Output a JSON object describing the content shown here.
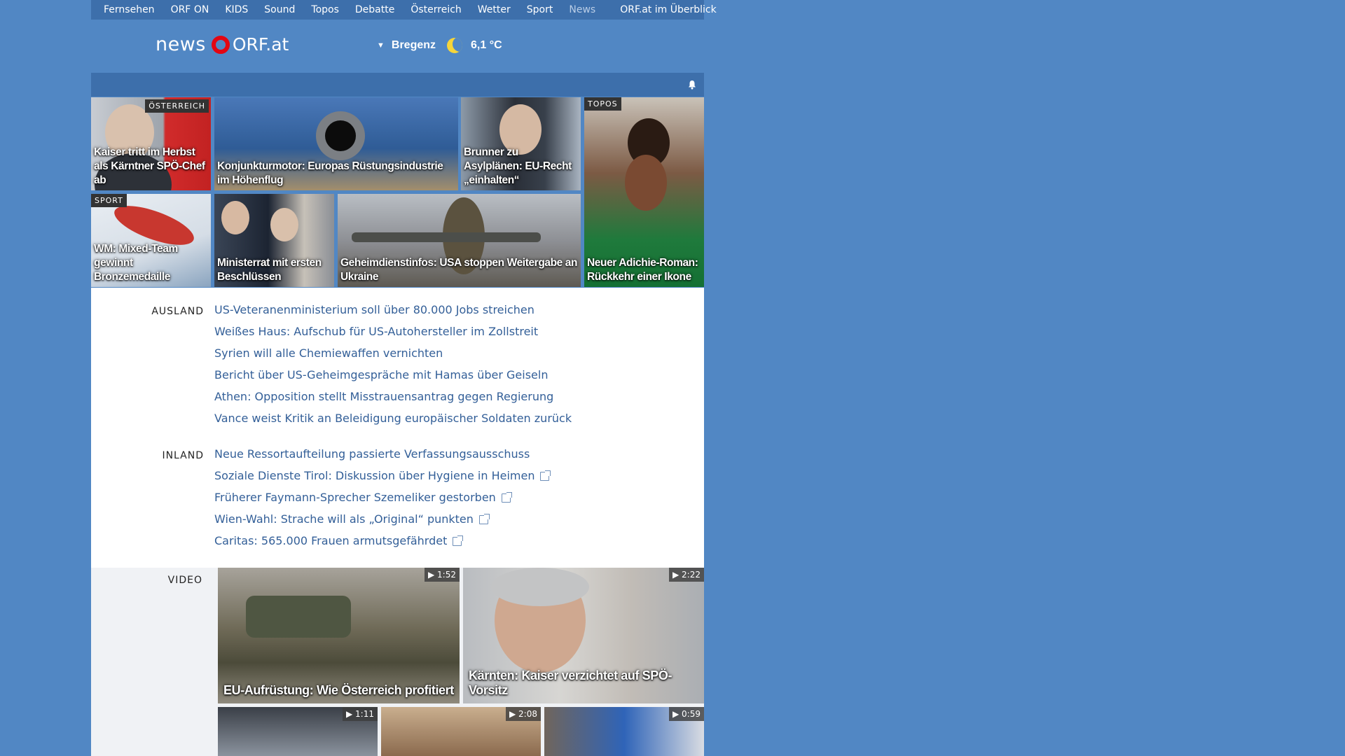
{
  "nav": {
    "items": [
      "Fernsehen",
      "ORF ON",
      "KIDS",
      "Sound",
      "Topos",
      "Debatte",
      "Österreich",
      "Wetter",
      "Sport"
    ],
    "current": "News",
    "overview": "ORF.at im Überblick"
  },
  "logo": {
    "news": "news",
    "orf": "ORF.at"
  },
  "weather": {
    "arrow": "▼",
    "city": "Bregenz",
    "temp": "6,1 °C",
    "icon": "moon-icon"
  },
  "teasers": {
    "t1": {
      "tag": "ÖSTERREICH",
      "caption": "Kaiser tritt im Herbst als Kärntner SPÖ-Chef ab"
    },
    "t2": {
      "caption": "Konjunkturmotor: Europas Rüstungsindustrie im Höhenflug"
    },
    "t3": {
      "caption": "Brunner zu Asylplänen: EU-Recht „einhalten“"
    },
    "t4": {
      "tag": "TOPOS",
      "caption": "Neuer Adichie-Roman: Rückkehr einer Ikone"
    },
    "t5": {
      "tag": "SPORT",
      "caption": "WM: Mixed-Team gewinnt Bronzemedaille"
    },
    "t6": {
      "caption": "Ministerrat mit ersten Beschlüssen"
    },
    "t7": {
      "caption": "Geheimdienstinfos: USA stoppen Weitergabe an Ukraine"
    }
  },
  "ausland": {
    "label": "AUSLAND",
    "items": [
      "US-Veteranenministerium soll über 80.000 Jobs streichen",
      "Weißes Haus: Aufschub für US-Autohersteller im Zollstreit",
      "Syrien will alle Chemiewaffen vernichten",
      "Bericht über US-Geheimgespräche mit Hamas über Geiseln",
      "Athen: Opposition stellt Misstrauensantrag gegen Regierung",
      "Vance weist Kritik an Beleidigung europäischer Soldaten zurück"
    ]
  },
  "inland": {
    "label": "INLAND",
    "items": [
      "Neue Ressortaufteilung passierte Verfassungsausschuss",
      "Soziale Dienste Tirol: Diskussion über Hygiene in Heimen",
      "Früherer Faymann-Sprecher Szemeliker gestorben",
      "Wien-Wahl: Strache will als „Original“ punkten",
      "Caritas: 565.000 Frauen armutsgefährdet"
    ]
  },
  "video": {
    "label": "VIDEO",
    "v1": {
      "duration": "▶ 1:52",
      "caption": "EU-Aufrüstung: Wie Österreich profitiert"
    },
    "v2": {
      "duration": "▶ 2:22",
      "caption": "Kärnten: Kaiser verzichtet auf SPÖ-Vorsitz"
    },
    "v3": {
      "duration": "▶ 1:11"
    },
    "v4": {
      "duration": "▶ 2:08"
    },
    "v5": {
      "duration": "▶ 0:59"
    }
  }
}
